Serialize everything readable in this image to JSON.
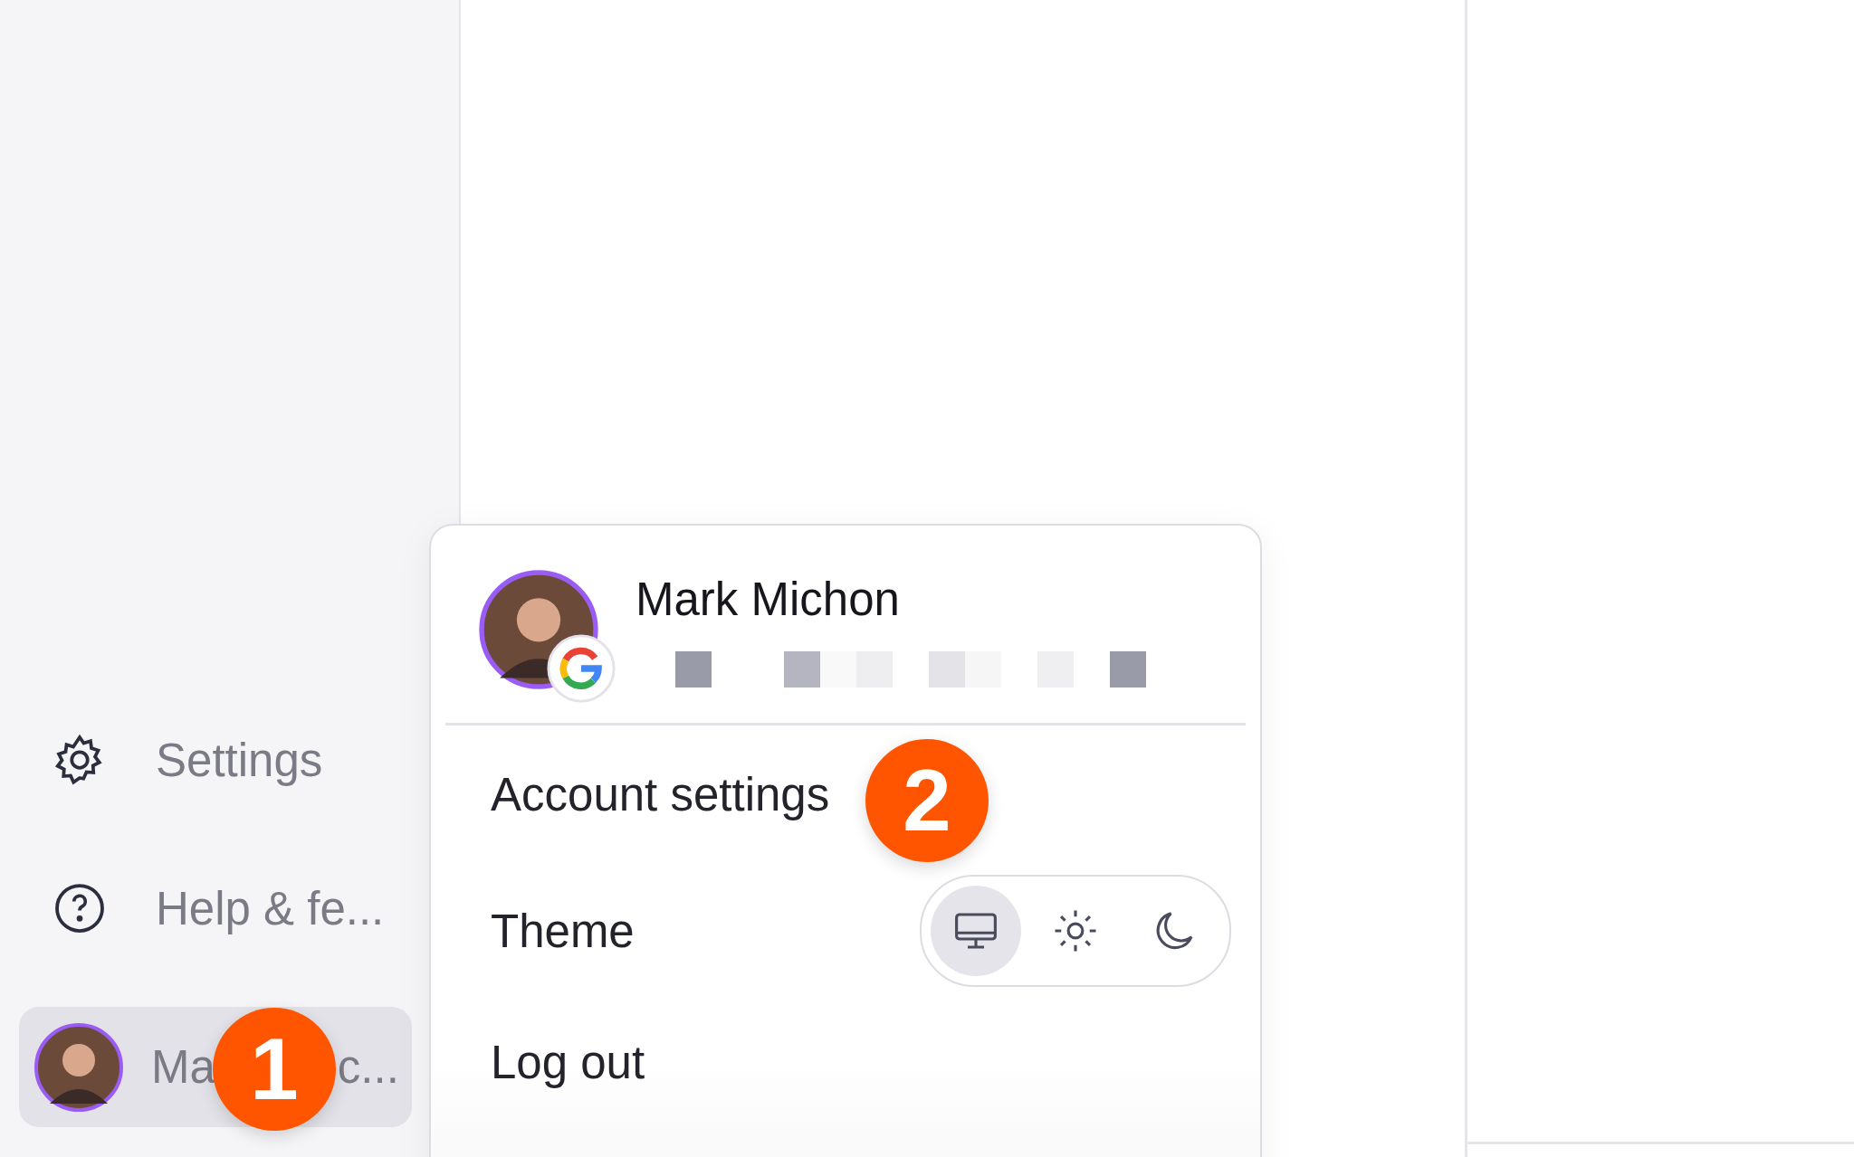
{
  "sidebar": {
    "items": [
      {
        "kind": "settings",
        "label": "Settings"
      },
      {
        "kind": "help",
        "label": "Help & fe..."
      }
    ],
    "user": {
      "label_start": "Ma",
      "label_end": "c...",
      "selected": true
    }
  },
  "account_menu": {
    "name": "Mark Michon",
    "items": [
      {
        "kind": "link",
        "label": "Account settings"
      },
      {
        "kind": "theme",
        "label": "Theme",
        "options": [
          {
            "kind": "system",
            "selected": true
          },
          {
            "kind": "light",
            "selected": false
          },
          {
            "kind": "dark",
            "selected": false
          }
        ]
      },
      {
        "kind": "link",
        "label": "Log out"
      }
    ]
  },
  "callouts": [
    {
      "label": "1"
    },
    {
      "label": "2"
    }
  ]
}
